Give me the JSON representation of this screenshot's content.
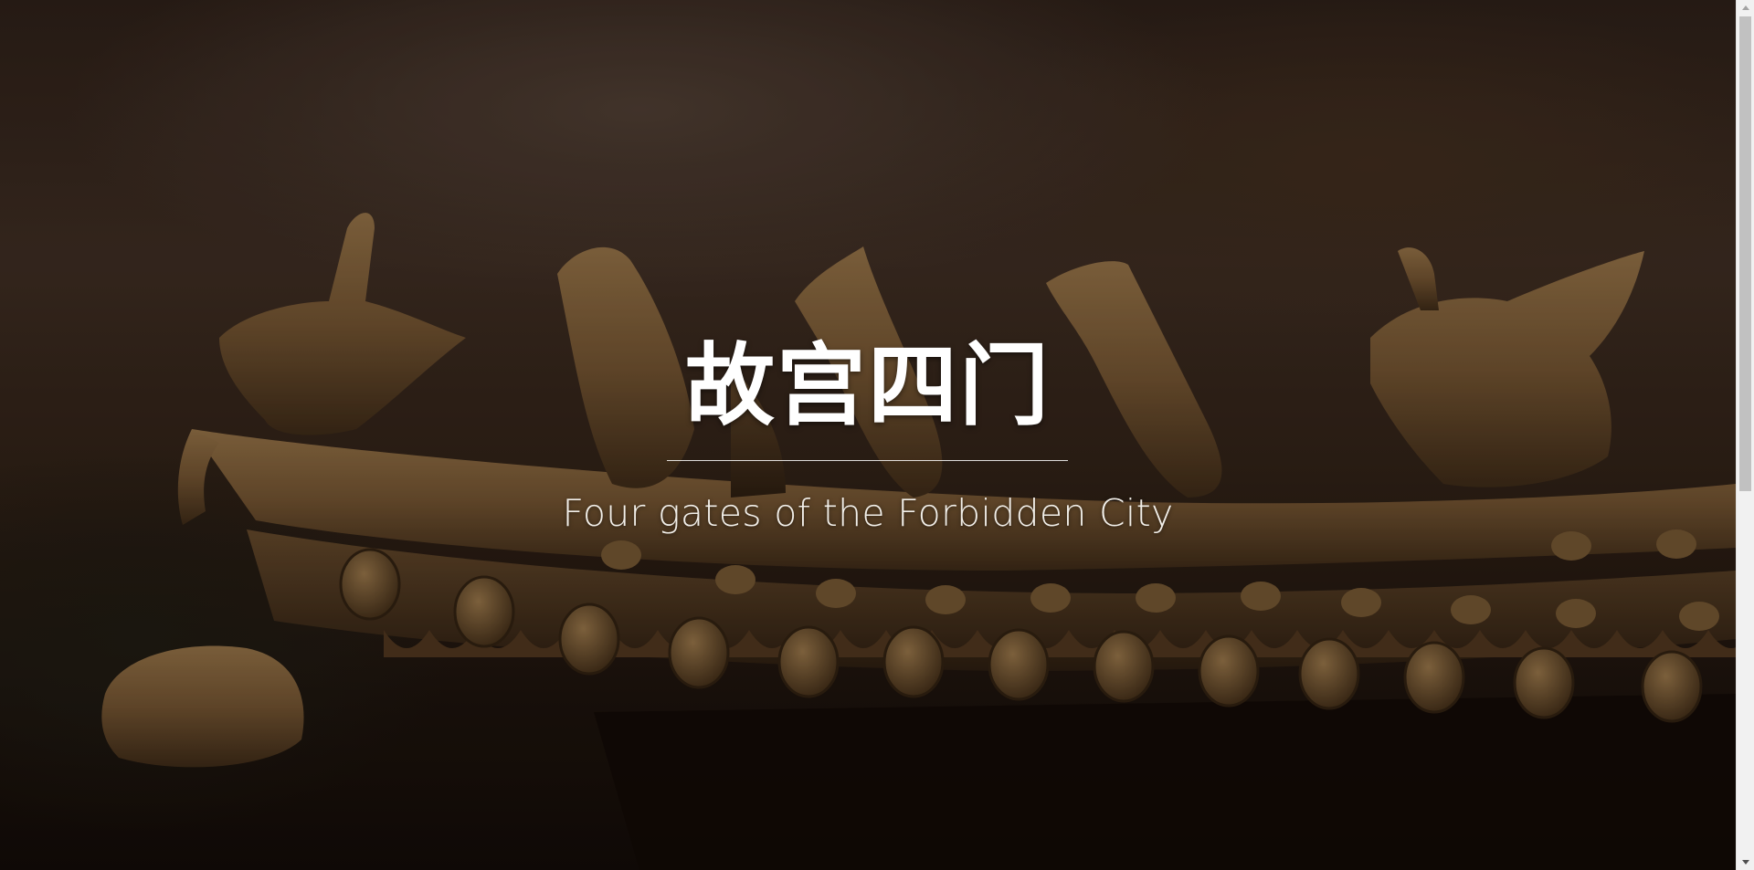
{
  "hero": {
    "title": "故宫四门",
    "subtitle": "Four gates of the Forbidden City"
  },
  "background": {
    "image": "bronze-roof-ridge-beasts-photo"
  },
  "colors": {
    "text": "#ffffff",
    "divider": "#ffffff",
    "background_dark": "#1a120d",
    "bronze": "#7a5a35"
  },
  "scrollbar": {
    "up_icon": "scroll-up-arrow-icon",
    "down_icon": "scroll-down-arrow-icon"
  }
}
